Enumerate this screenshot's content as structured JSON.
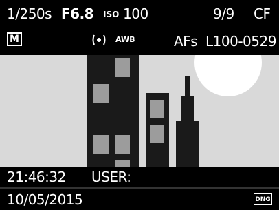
{
  "top_bar": {
    "shutter": "1/250s",
    "aperture": "F6.8",
    "iso_label": "ISO",
    "iso_value": "100",
    "frame_counter": "9/9",
    "card": "CF"
  },
  "second_bar": {
    "mode": "M",
    "metering_icon": "spot-metering-icon",
    "white_balance": "AWB",
    "focus_mode": "AFs",
    "file_number": "L100-0529"
  },
  "bottom_bar": {
    "time": "21:46:32",
    "user_label": "USER:",
    "date": "10/05/2015",
    "file_format": "DNG"
  },
  "colors": {
    "background": "#000000",
    "text": "#ffffff",
    "scene_sky": "#d9d9d9",
    "building": "#1a1a1a",
    "window": "#9c9c9c",
    "sun": "#ffffff"
  }
}
